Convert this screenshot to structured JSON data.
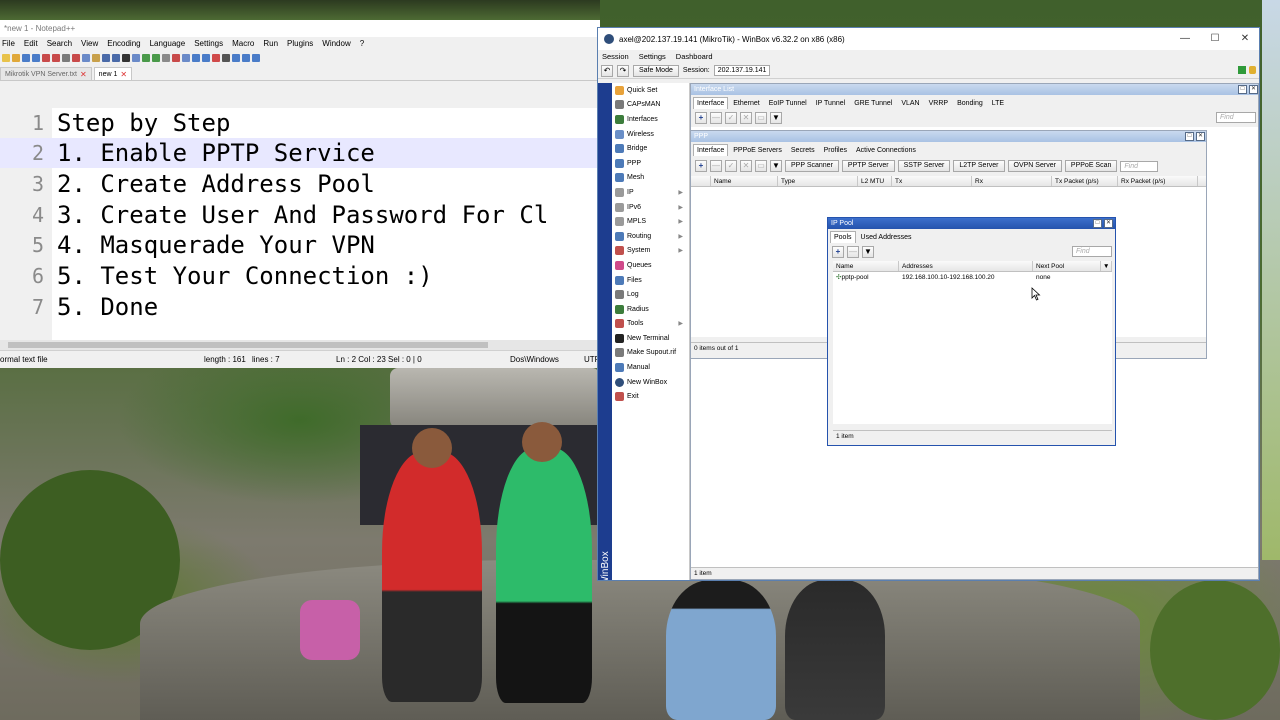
{
  "notepad": {
    "title": "*new 1 - Notepad++",
    "menu": [
      "File",
      "Edit",
      "Search",
      "View",
      "Encoding",
      "Language",
      "Settings",
      "Macro",
      "Run",
      "Plugins",
      "Window",
      "?"
    ],
    "tabs": [
      {
        "label": "Mikrotik VPN Server.txt",
        "active": false
      },
      {
        "label": "new 1",
        "active": true
      }
    ],
    "lines": [
      {
        "num": "1",
        "text": "Step by Step"
      },
      {
        "num": "2",
        "text": "1. Enable PPTP Service"
      },
      {
        "num": "3",
        "text": "2. Create Address Pool"
      },
      {
        "num": "4",
        "text": "3. Create User And Password For Cl"
      },
      {
        "num": "5",
        "text": "4. Masquerade Your VPN"
      },
      {
        "num": "6",
        "text": "5. Test Your Connection :)"
      },
      {
        "num": "7",
        "text": "5. Done"
      }
    ],
    "status": {
      "type": "ormal text file",
      "length": "length : 161",
      "lines": "lines : 7",
      "pos": "Ln : 2   Col : 23   Sel : 0 | 0",
      "eol": "Dos\\Windows",
      "enc": "UTF"
    }
  },
  "winbox": {
    "title": "axel@202.137.19.141 (MikroTik) - WinBox v6.32.2 on x86 (x86)",
    "menu": [
      "Session",
      "Settings",
      "Dashboard"
    ],
    "safe_mode": "Safe Mode",
    "session_label": "Session:",
    "session_value": "202.137.19.141",
    "sidebar_label": "RouterOS WinBox",
    "menu_items": [
      {
        "label": "Quick Set",
        "color": "#e8a23a",
        "arrow": false
      },
      {
        "label": "CAPsMAN",
        "color": "#7a7a7a",
        "arrow": false
      },
      {
        "label": "Interfaces",
        "color": "#3c7d3c",
        "arrow": false
      },
      {
        "label": "Wireless",
        "color": "#6a8fc8",
        "arrow": false
      },
      {
        "label": "Bridge",
        "color": "#4d7ab8",
        "arrow": false
      },
      {
        "label": "PPP",
        "color": "#4d7ab8",
        "arrow": false
      },
      {
        "label": "Mesh",
        "color": "#4d7ab8",
        "arrow": false
      },
      {
        "label": "IP",
        "color": "#9a9a9a",
        "arrow": true
      },
      {
        "label": "IPv6",
        "color": "#9a9a9a",
        "arrow": true
      },
      {
        "label": "MPLS",
        "color": "#9a9a9a",
        "arrow": true
      },
      {
        "label": "Routing",
        "color": "#4d7ab8",
        "arrow": true
      },
      {
        "label": "System",
        "color": "#c0504d",
        "arrow": true
      },
      {
        "label": "Queues",
        "color": "#d04a8a",
        "arrow": false
      },
      {
        "label": "Files",
        "color": "#4d7ab8",
        "arrow": false
      },
      {
        "label": "Log",
        "color": "#7a7a7a",
        "arrow": false
      },
      {
        "label": "Radius",
        "color": "#3c7d3c",
        "arrow": false
      },
      {
        "label": "Tools",
        "color": "#c0504d",
        "arrow": true
      },
      {
        "label": "New Terminal",
        "color": "#222222",
        "arrow": false
      },
      {
        "label": "Make Supout.rif",
        "color": "#7a7a7a",
        "arrow": false
      },
      {
        "label": "Manual",
        "color": "#4d7ab8",
        "arrow": false
      },
      {
        "label": "New WinBox",
        "color": "#2f4e7a",
        "arrow": false
      },
      {
        "label": "Exit",
        "color": "#c0504d",
        "arrow": false
      }
    ],
    "interface_list": {
      "title": "Interface List",
      "tabs": [
        "Interface",
        "Ethernet",
        "EoIP Tunnel",
        "IP Tunnel",
        "GRE Tunnel",
        "VLAN",
        "VRRP",
        "Bonding",
        "LTE"
      ],
      "find": "Find",
      "footer": "1 item"
    },
    "ppp": {
      "title": "PPP",
      "tabs": [
        "Interface",
        "PPPoE Servers",
        "Secrets",
        "Profiles",
        "Active Connections"
      ],
      "buttons": [
        "PPP Scanner",
        "PPTP Server",
        "SSTP Server",
        "L2TP Server",
        "OVPN Server",
        "PPPoE Scan"
      ],
      "find": "Find",
      "columns": [
        "Name",
        "Type",
        "L2 MTU",
        "Tx",
        "Rx",
        "Tx Packet (p/s)",
        "Rx Packet (p/s)"
      ],
      "footer": "0 items out of 1"
    },
    "ip_pool": {
      "title": "IP Pool",
      "tabs": [
        "Pools",
        "Used Addresses"
      ],
      "find": "Find",
      "columns": [
        "Name",
        "Addresses",
        "Next Pool"
      ],
      "rows": [
        {
          "name": "pptp-pool",
          "addresses": "192.168.100.10-192.168.100.20",
          "next": "none"
        }
      ],
      "footer": "1 item"
    }
  }
}
